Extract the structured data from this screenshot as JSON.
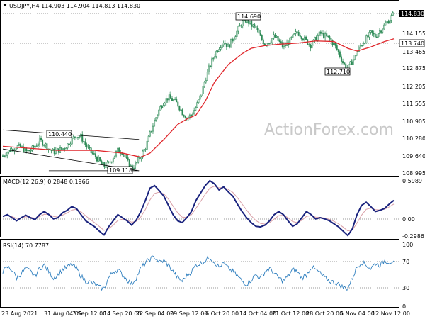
{
  "main_panel": {
    "title": "USDJPY,H4  114.903 114.904 114.813 114.830",
    "price_labels": [
      "114.155",
      "113.465",
      "112.875",
      "112.205",
      "111.555",
      "110.905",
      "110.280",
      "109.640",
      "108.995"
    ],
    "current_price": "114.830",
    "ma_price": "113.740",
    "watermark": "ActionForex.com",
    "annotations": [
      "110.440",
      "109.118",
      "114.690",
      "112.710"
    ]
  },
  "macd_panel": {
    "title": "MACD(12,26,9) 0.2848 0.1966",
    "labels": [
      "0.5989",
      "0.00",
      "-0.2986"
    ]
  },
  "rsi_panel": {
    "title": "RSI(14) 70.7787",
    "labels": [
      "100",
      "70",
      "30",
      "0"
    ]
  },
  "x_axis": {
    "labels": [
      "23 Aug 2021",
      "31 Aug 04:00",
      "7 Sep 12:00",
      "14 Sep 20:00",
      "22 Sep 04:00",
      "29 Sep 12:00",
      "6 Oct 20:00",
      "14 Oct 04:00",
      "21 Oct 12:00",
      "28 Oct 20:00",
      "5 Nov 04:00",
      "12 Nov 12:00"
    ]
  },
  "colors": {
    "candle": "#2e8b57",
    "ma": "#e0262b",
    "macd": "#1a237e",
    "signal": "#d9a0a8",
    "rsi": "#2f7fbf",
    "grid_dotted": "#999999",
    "trendline": "#000000"
  },
  "chart_data": [
    {
      "type": "candlestick",
      "title": "USDJPY,H4",
      "ylim": [
        108.995,
        114.83
      ],
      "x_labels": [
        "23 Aug 2021",
        "31 Aug 04:00",
        "7 Sep 12:00",
        "14 Sep 20:00",
        "22 Sep 04:00",
        "29 Sep 12:00",
        "6 Oct 20:00",
        "14 Oct 04:00",
        "21 Oct 12:00",
        "28 Oct 20:00",
        "5 Nov 04:00",
        "12 Nov 12:00"
      ],
      "close_path": [
        [
          0,
          109.6
        ],
        [
          5,
          109.75
        ],
        [
          10,
          109.85
        ],
        [
          15,
          109.95
        ],
        [
          20,
          109.9
        ],
        [
          25,
          109.75
        ],
        [
          30,
          109.8
        ],
        [
          35,
          109.95
        ],
        [
          40,
          110.15
        ],
        [
          45,
          110.05
        ],
        [
          50,
          109.85
        ],
        [
          55,
          109.75
        ],
        [
          60,
          109.8
        ],
        [
          65,
          109.85
        ],
        [
          70,
          110.0
        ],
        [
          75,
          110.2
        ],
        [
          80,
          110.35
        ],
        [
          85,
          110.3
        ],
        [
          90,
          110.0
        ],
        [
          95,
          109.75
        ],
        [
          100,
          109.6
        ],
        [
          105,
          109.4
        ],
        [
          110,
          109.2
        ],
        [
          115,
          109.3
        ],
        [
          120,
          109.55
        ],
        [
          125,
          109.8
        ],
        [
          130,
          109.75
        ],
        [
          135,
          109.4
        ],
        [
          140,
          109.15
        ],
        [
          145,
          109.3
        ],
        [
          150,
          109.6
        ],
        [
          155,
          109.9
        ],
        [
          160,
          110.4
        ],
        [
          165,
          110.9
        ],
        [
          170,
          111.3
        ],
        [
          175,
          111.6
        ],
        [
          180,
          111.75
        ],
        [
          185,
          111.65
        ],
        [
          190,
          111.5
        ],
        [
          195,
          111.2
        ],
        [
          200,
          111.0
        ],
        [
          205,
          111.1
        ],
        [
          210,
          111.4
        ],
        [
          215,
          111.8
        ],
        [
          220,
          112.4
        ],
        [
          225,
          112.9
        ],
        [
          230,
          113.3
        ],
        [
          235,
          113.6
        ],
        [
          240,
          113.8
        ],
        [
          245,
          113.6
        ],
        [
          250,
          113.9
        ],
        [
          255,
          114.2
        ],
        [
          260,
          114.5
        ],
        [
          265,
          114.6
        ],
        [
          270,
          114.4
        ],
        [
          275,
          114.3
        ],
        [
          280,
          113.95
        ],
        [
          285,
          113.7
        ],
        [
          290,
          113.8
        ],
        [
          295,
          114.0
        ],
        [
          300,
          113.8
        ],
        [
          305,
          113.6
        ],
        [
          310,
          113.75
        ],
        [
          315,
          113.95
        ],
        [
          320,
          114.15
        ],
        [
          325,
          114.0
        ],
        [
          330,
          113.8
        ],
        [
          335,
          113.65
        ],
        [
          340,
          113.9
        ],
        [
          345,
          114.1
        ],
        [
          350,
          114.0
        ],
        [
          355,
          113.9
        ],
        [
          360,
          113.7
        ],
        [
          365,
          113.4
        ],
        [
          370,
          113.0
        ],
        [
          375,
          112.8
        ],
        [
          380,
          113.1
        ],
        [
          385,
          113.4
        ],
        [
          390,
          113.7
        ],
        [
          395,
          113.9
        ],
        [
          400,
          114.1
        ],
        [
          405,
          114.0
        ],
        [
          410,
          114.2
        ],
        [
          415,
          114.4
        ],
        [
          420,
          114.6
        ],
        [
          425,
          114.83
        ]
      ],
      "ma_path": [
        [
          0,
          109.95
        ],
        [
          60,
          109.8
        ],
        [
          100,
          109.8
        ],
        [
          130,
          109.7
        ],
        [
          150,
          109.55
        ],
        [
          160,
          109.7
        ],
        [
          175,
          110.2
        ],
        [
          190,
          110.75
        ],
        [
          200,
          110.95
        ],
        [
          210,
          111.1
        ],
        [
          220,
          111.6
        ],
        [
          230,
          112.3
        ],
        [
          245,
          112.95
        ],
        [
          260,
          113.35
        ],
        [
          270,
          113.55
        ],
        [
          285,
          113.65
        ],
        [
          300,
          113.7
        ],
        [
          320,
          113.74
        ],
        [
          340,
          113.82
        ],
        [
          360,
          113.8
        ],
        [
          375,
          113.55
        ],
        [
          385,
          113.45
        ],
        [
          400,
          113.6
        ],
        [
          415,
          113.8
        ],
        [
          425,
          113.9
        ]
      ],
      "trendlines": [
        {
          "from": [
            0,
            110.55
          ],
          "to": [
            148,
            110.2
          ]
        },
        {
          "from": [
            0,
            109.85
          ],
          "to": [
            148,
            109.05
          ]
        },
        {
          "from": [
            50,
            109.05
          ],
          "to": [
            148,
            109.05
          ]
        }
      ],
      "annotations": [
        "110.440",
        "109.118",
        "114.690",
        "112.710"
      ]
    },
    {
      "type": "line",
      "title": "MACD(12,26,9)",
      "ylim": [
        -0.2986,
        0.5989
      ],
      "series": [
        {
          "name": "MACD",
          "x": [
            0,
            5,
            10,
            15,
            20,
            25,
            30,
            35,
            40,
            45,
            50,
            55,
            60,
            65,
            70,
            75,
            80,
            85,
            90,
            95,
            100,
            105,
            110,
            115,
            120,
            125,
            130,
            135,
            140,
            145,
            150,
            155,
            160,
            165,
            170,
            175,
            180,
            185,
            190,
            195,
            200,
            205,
            210,
            215,
            220,
            225,
            230,
            235,
            240,
            245,
            250,
            255,
            260,
            265,
            270,
            275,
            280,
            285,
            290,
            295,
            300,
            305,
            310,
            315,
            320,
            325,
            330,
            335,
            340,
            345,
            350,
            355,
            360,
            365,
            370,
            375,
            380,
            385,
            390,
            395,
            400,
            405,
            410,
            415,
            420,
            425
          ],
          "values": [
            0.02,
            0.05,
            0.0,
            -0.05,
            0.0,
            0.04,
            0.0,
            -0.03,
            0.05,
            0.1,
            0.05,
            -0.02,
            0.0,
            0.08,
            0.12,
            0.18,
            0.15,
            0.05,
            -0.05,
            -0.1,
            -0.15,
            -0.22,
            -0.28,
            -0.15,
            -0.05,
            0.05,
            0.0,
            -0.05,
            -0.12,
            -0.04,
            0.1,
            0.28,
            0.48,
            0.52,
            0.44,
            0.35,
            0.2,
            0.05,
            -0.05,
            -0.08,
            0.0,
            0.1,
            0.28,
            0.4,
            0.52,
            0.6,
            0.55,
            0.45,
            0.5,
            0.42,
            0.35,
            0.22,
            0.1,
            0.0,
            -0.08,
            -0.14,
            -0.15,
            -0.12,
            -0.05,
            0.05,
            0.1,
            0.05,
            -0.05,
            -0.14,
            -0.1,
            0.0,
            0.1,
            0.05,
            -0.02,
            0.0,
            -0.02,
            -0.05,
            -0.1,
            -0.15,
            -0.22,
            -0.29,
            -0.18,
            0.05,
            0.2,
            0.25,
            0.18,
            0.1,
            0.12,
            0.15,
            0.22,
            0.28
          ]
        }
      ]
    },
    {
      "type": "line",
      "title": "RSI(14)",
      "ylim": [
        0,
        100
      ],
      "series": [
        {
          "name": "RSI",
          "x": [
            0,
            5,
            10,
            15,
            20,
            25,
            30,
            35,
            40,
            45,
            50,
            55,
            60,
            65,
            70,
            75,
            80,
            85,
            90,
            95,
            100,
            105,
            110,
            115,
            120,
            125,
            130,
            135,
            140,
            145,
            150,
            155,
            160,
            165,
            170,
            175,
            180,
            185,
            190,
            195,
            200,
            205,
            210,
            215,
            220,
            225,
            230,
            235,
            240,
            245,
            250,
            255,
            260,
            265,
            270,
            275,
            280,
            285,
            290,
            295,
            300,
            305,
            310,
            315,
            320,
            325,
            330,
            335,
            340,
            345,
            350,
            355,
            360,
            365,
            370,
            375,
            380,
            385,
            390,
            395,
            400,
            405,
            410,
            415,
            420,
            425
          ],
          "values": [
            55,
            62,
            58,
            45,
            52,
            60,
            55,
            48,
            60,
            65,
            55,
            45,
            50,
            58,
            62,
            66,
            60,
            48,
            40,
            38,
            35,
            30,
            28,
            45,
            55,
            58,
            50,
            42,
            35,
            45,
            60,
            68,
            75,
            78,
            70,
            72,
            65,
            55,
            45,
            40,
            48,
            55,
            65,
            68,
            72,
            78,
            70,
            62,
            68,
            60,
            55,
            48,
            40,
            35,
            42,
            50,
            45,
            55,
            60,
            52,
            45,
            40,
            48,
            58,
            55,
            45,
            50,
            62,
            58,
            52,
            45,
            40,
            38,
            35,
            30,
            28,
            45,
            62,
            70,
            65,
            60,
            68,
            65,
            72,
            70,
            72
          ]
        }
      ]
    }
  ]
}
